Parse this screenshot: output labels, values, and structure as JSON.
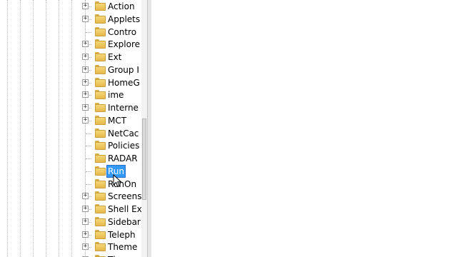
{
  "tree": {
    "items": [
      {
        "label": "Action",
        "expandable": true
      },
      {
        "label": "Applets",
        "expandable": true
      },
      {
        "label": "Contro",
        "expandable": false
      },
      {
        "label": "Explore",
        "expandable": true
      },
      {
        "label": "Ext",
        "expandable": true
      },
      {
        "label": "Group I",
        "expandable": true
      },
      {
        "label": "HomeG",
        "expandable": true
      },
      {
        "label": "ime",
        "expandable": true
      },
      {
        "label": "Interne",
        "expandable": true
      },
      {
        "label": "MCT",
        "expandable": true
      },
      {
        "label": "NetCac",
        "expandable": false
      },
      {
        "label": "Policies",
        "expandable": false
      },
      {
        "label": "RADAR",
        "expandable": false
      },
      {
        "label": "Run",
        "expandable": false,
        "selected": true
      },
      {
        "label": "RunOn",
        "expandable": false
      },
      {
        "label": "Screens",
        "expandable": true
      },
      {
        "label": "Shell Ex",
        "expandable": true
      },
      {
        "label": "Sidebar",
        "expandable": true
      },
      {
        "label": "Teleph",
        "expandable": true
      },
      {
        "label": "Theme",
        "expandable": true
      },
      {
        "label": "Them",
        "expandable": true
      }
    ],
    "expander_glyph": "+",
    "folder_icon": "folder-icon"
  },
  "colors": {
    "selection_bg": "#3399ff",
    "selection_text": "#ffffff",
    "folder": "#f0cc66"
  },
  "cursor_icon": "mouse-pointer-icon"
}
